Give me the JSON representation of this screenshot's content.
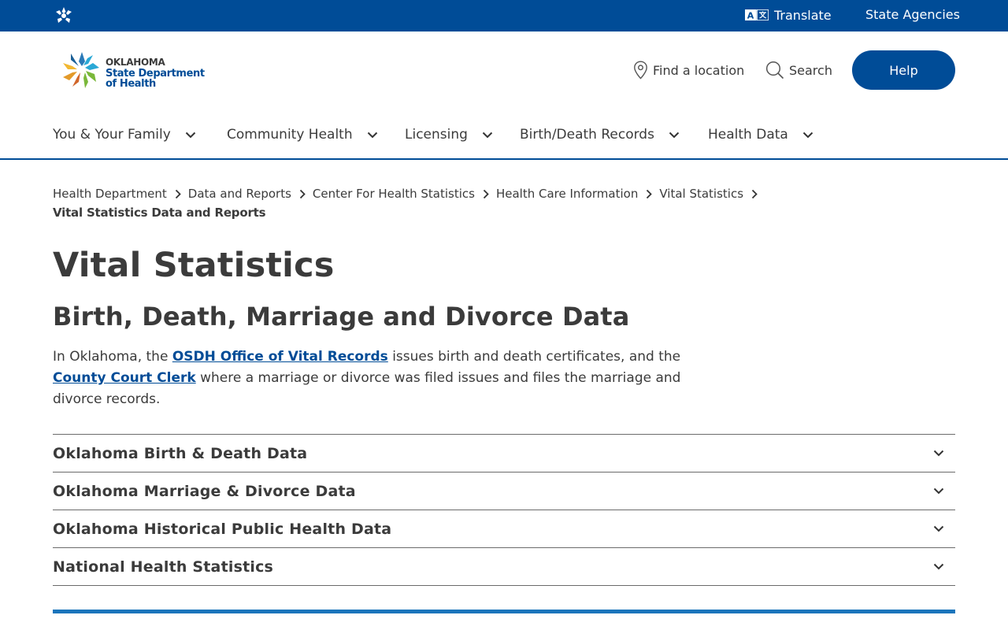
{
  "topbar": {
    "star_icon": "oklahoma-star-icon",
    "translate_label": "Translate",
    "translate_icon": "translate-icon",
    "agencies_label": "State Agencies"
  },
  "logo": {
    "line1": "OKLAHOMA",
    "line2": "State Department",
    "line3": "of Health"
  },
  "header": {
    "find_label": "Find a location",
    "find_icon": "map-pin-icon",
    "search_label": "Search",
    "search_icon": "search-icon",
    "help_label": "Help"
  },
  "nav": {
    "items": [
      {
        "label": "You & Your Family"
      },
      {
        "label": "Community Health"
      },
      {
        "label": "Licensing"
      },
      {
        "label": "Birth/Death Records"
      },
      {
        "label": "Health Data"
      }
    ]
  },
  "breadcrumb": {
    "items": [
      {
        "label": "Health Department"
      },
      {
        "label": "Data and Reports"
      },
      {
        "label": "Center For Health Statistics"
      },
      {
        "label": "Health Care Information"
      },
      {
        "label": "Vital Statistics"
      }
    ],
    "current": "Vital Statistics Data and Reports"
  },
  "page": {
    "title": "Vital Statistics",
    "subtitle": "Birth, Death, Marriage and Divorce Data",
    "intro_p1": "In Oklahoma, the ",
    "intro_link1": "OSDH Office of Vital Records",
    "intro_p2": " issues birth and death certificates, and the ",
    "intro_link2": "County Court Clerk",
    "intro_p3": " where a marriage or divorce was filed issues and files the marriage and divorce records."
  },
  "accordion": {
    "items": [
      {
        "title": "Oklahoma Birth & Death Data"
      },
      {
        "title": "Oklahoma Marriage & Divorce Data"
      },
      {
        "title": "Oklahoma Historical Public Health Data"
      },
      {
        "title": "National Health Statistics"
      }
    ]
  },
  "colors": {
    "brand_blue": "#004c97",
    "accent_blue": "#1b75bc",
    "text": "#3b3b3b"
  }
}
